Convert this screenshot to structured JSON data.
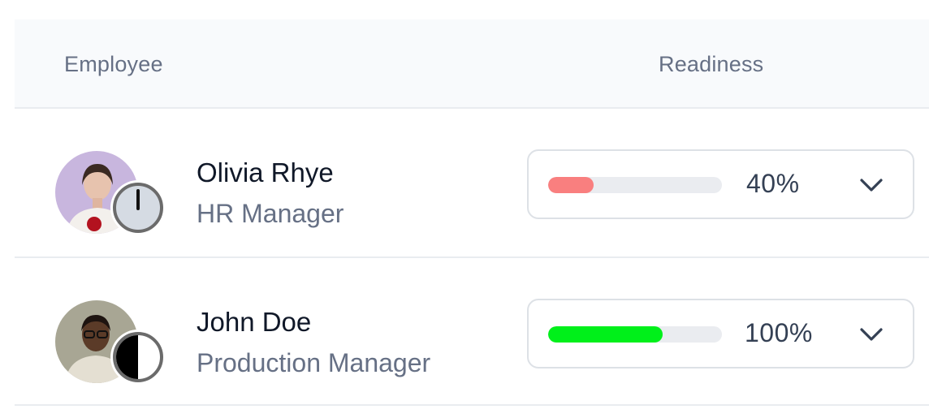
{
  "table": {
    "headers": {
      "employee": "Employee",
      "readiness": "Readiness"
    },
    "rows": [
      {
        "name": "Olivia Rhye",
        "role": "HR Manager",
        "readiness_label": "40%",
        "readiness_value": 0.4,
        "readiness_color": "#f97f7f",
        "avatar_icon": "avatar-photo",
        "status_icon": "clock-status-icon"
      },
      {
        "name": "John Doe",
        "role": "Production Manager",
        "readiness_label": "100%",
        "readiness_value": 1.0,
        "readiness_color": "#00f01a",
        "avatar_icon": "avatar-photo",
        "status_icon": "half-moon-status-icon"
      }
    ]
  },
  "colors": {
    "header_bg": "#f8fafc",
    "text_primary": "#101828",
    "text_secondary": "#667085",
    "border": "#dde1e6"
  }
}
